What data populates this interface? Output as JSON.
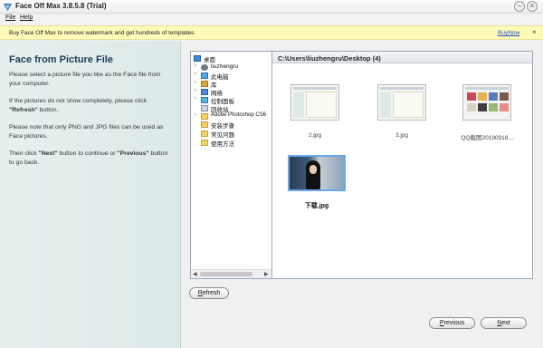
{
  "window": {
    "title": "Face Off Max  3.8.5.8  (Trial)",
    "minimize_glyph": "–",
    "close_glyph": "×"
  },
  "menu": {
    "file": "File",
    "help": "Help"
  },
  "banner": {
    "text": "Buy Face Off Max to remove watermark and get hundreds of templates.",
    "link": "BuyNow",
    "close_glyph": "×"
  },
  "left_panel": {
    "title": "Face from Picture File",
    "p1": "Please select a picture file you like as the Face file from your computer.",
    "p2_a": "If the pictures do not show completely, please click ",
    "p2_b": "\"Refresh\"",
    "p2_c": " button.",
    "p3": "Please note that only PNG and JPG files can be used as Face pictures.",
    "p4_a": "Then click ",
    "p4_b": "\"Next\"",
    "p4_c": " button to continue or ",
    "p4_d": "\"Previous\"",
    "p4_e": " button to go back."
  },
  "tree": {
    "items": [
      {
        "label": "桌面",
        "icon": "desktop-icon"
      },
      {
        "label": "liuzhengru",
        "icon": "user-folder-icon"
      },
      {
        "label": "此电脑",
        "icon": "computer-icon"
      },
      {
        "label": "库",
        "icon": "library-icon"
      },
      {
        "label": "网络",
        "icon": "network-icon"
      },
      {
        "label": "控制面板",
        "icon": "control-panel-icon"
      },
      {
        "label": "回收站",
        "icon": "recycle-bin-icon"
      },
      {
        "label": "Adobe Photoshop CS6",
        "icon": "folder-icon"
      },
      {
        "label": "安装步骤",
        "icon": "folder-icon"
      },
      {
        "label": "常见问题",
        "icon": "folder-icon"
      },
      {
        "label": "使用方法",
        "icon": "folder-icon"
      }
    ],
    "expander_glyph": "›"
  },
  "files": {
    "path": "C:\\Users\\liuzhengru\\Desktop (4)",
    "items": [
      {
        "name": "2.jpg",
        "selected": false
      },
      {
        "name": "3.jpg",
        "selected": false
      },
      {
        "name": "QQ截图20190918....",
        "selected": false
      },
      {
        "name": "下载.jpg",
        "selected": true
      }
    ]
  },
  "buttons": {
    "refresh_u": "R",
    "refresh_rest": "efresh",
    "prev_u": "P",
    "prev_rest": "revious",
    "next_u": "N",
    "next_rest": "ext"
  },
  "colors": {
    "banner_bg": "#fdfbb8",
    "link": "#1a4fd8",
    "title_text": "#1d3b58",
    "selection": "#6aa8e8"
  }
}
